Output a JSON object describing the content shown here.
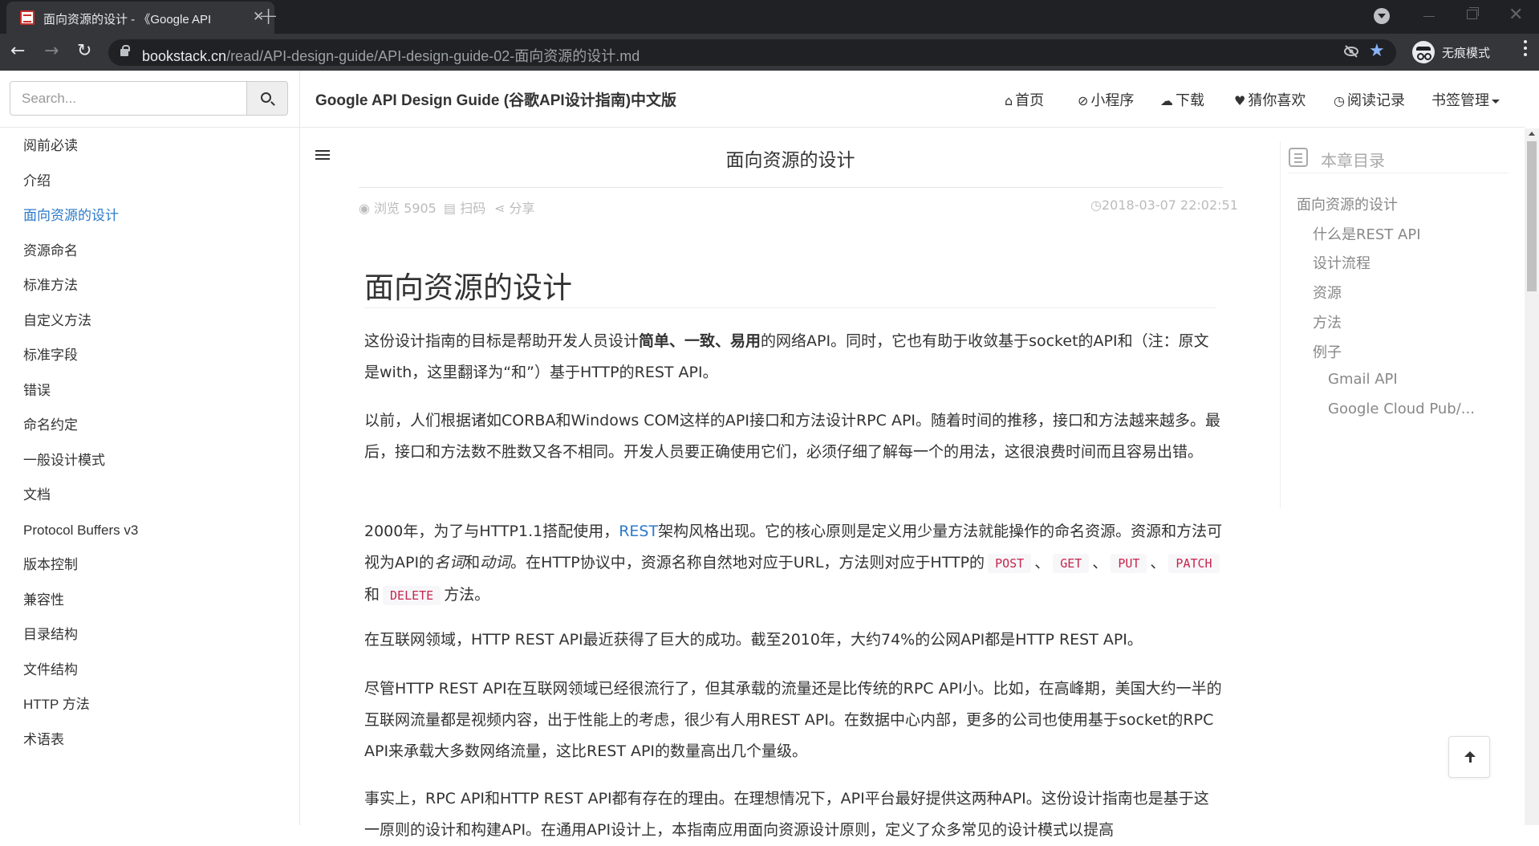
{
  "browser": {
    "tab_title": "面向资源的设计 - 《Google API",
    "tab_close": "✕",
    "new_tab": "+",
    "nav_back": "←",
    "nav_forward": "→",
    "nav_reload": "↻",
    "url_host": "bookstack.cn",
    "url_path": "/read/API-design-guide/API-design-guide-02-面向资源的设计.md",
    "star": "★",
    "incognito_label": "无痕模式",
    "close_window": "✕"
  },
  "header": {
    "search_placeholder": "Search...",
    "book_title": "Google API Design Guide (谷歌API设计指南)中文版",
    "nav": {
      "home": "首页",
      "mini_program": "小程序",
      "download": "下载",
      "guess_like": "猜你喜欢",
      "history": "阅读记录",
      "bookmarks": "书签管理"
    },
    "nav_icons": {
      "home": "⌂",
      "mini_program": "⊘",
      "download": "☁",
      "guess_like": "♥",
      "history": "◷"
    }
  },
  "sidebar": {
    "items": [
      "阅前必读",
      "介绍",
      "面向资源的设计",
      "资源命名",
      "标准方法",
      "自定义方法",
      "标准字段",
      "错误",
      "命名约定",
      "一般设计模式",
      "文档",
      "Protocol Buffers v3",
      "版本控制",
      "兼容性",
      "目录结构",
      "文件结构",
      "HTTP 方法",
      "术语表"
    ],
    "active_index": 2
  },
  "article": {
    "page_title": "面向资源的设计",
    "views": "浏览 5905",
    "scan": "扫码",
    "share": "分享",
    "date": "2018-03-07 22:02:51",
    "h1": "面向资源的设计",
    "p1_a": "这份设计指南的目标是帮助开发人员设计",
    "p1_b": "简单、一致、易用",
    "p1_c": "的网络API。同时，它也有助于收敛基于socket的API和（注：原文是with，这里翻译为“和”）基于HTTP的REST API。",
    "p2": "以前，人们根据诸如CORBA和Windows COM这样的API接口和方法设计RPC API。随着时间的推移，接口和方法越来越多。最后，接口和方法数不胜数又各不相同。开发人员要正确使用它们，必须仔细了解每一个的用法，这很浪费时间而且容易出错。",
    "p3_a": "2000年，为了与HTTP1.1搭配使用，",
    "p3_link": "REST",
    "p3_b": "架构风格出现。它的核心原则是定义用少量方法就能操作的命名资源。资源和方法可视为API的",
    "p3_noun": "名词",
    "p3_and": "和",
    "p3_verb": "动词",
    "p3_c": "。在HTTP协议中，资源名称自然地对应于URL，方法则对应于HTTP的",
    "code_post": "POST",
    "code_get": "GET",
    "code_put": "PUT",
    "code_patch": "PATCH",
    "code_delete": "DELETE",
    "sep1": "、",
    "sep2": "、",
    "sep3": "、",
    "and": "和",
    "p3_end": "方法。",
    "p4": "在互联网领域，HTTP REST API最近获得了巨大的成功。截至2010年，大约74%的公网API都是HTTP REST API。",
    "p5": "尽管HTTP REST API在互联网领域已经很流行了，但其承载的流量还是比传统的RPC API小。比如，在高峰期，美国大约一半的互联网流量都是视频内容，出于性能上的考虑，很少有人用REST API。在数据中心内部，更多的公司也使用基于socket的RPC API来承载大多数网络流量，这比REST API的数量高出几个量级。",
    "p6": "事实上，RPC API和HTTP REST API都有存在的理由。在理想情况下，API平台最好提供这两种API。这份设计指南也是基于这一原则的设计和构建API。在通用API设计上，本指南应用面向资源设计原则，定义了众多常见的设计模式以提高"
  },
  "toc": {
    "heading": "本章目录",
    "items": [
      "面向资源的设计",
      "什么是REST API",
      "设计流程",
      "资源",
      "方法",
      "例子",
      "Gmail API",
      "Google Cloud Pub/..."
    ]
  }
}
